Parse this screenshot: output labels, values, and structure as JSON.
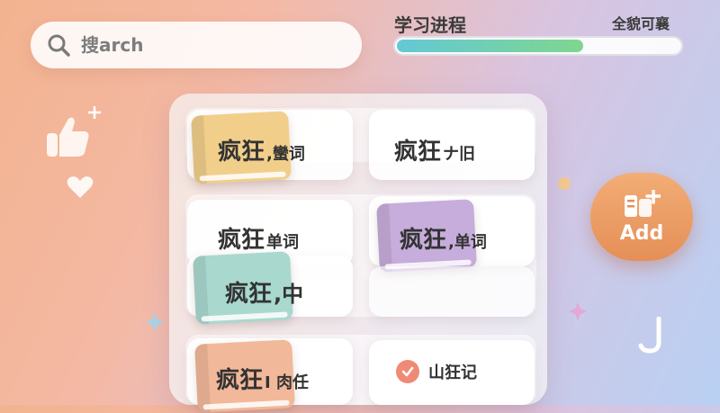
{
  "search": {
    "placeholder": "搜arch"
  },
  "progress": {
    "title": "学习进程",
    "right_label": "全貌可襄",
    "fraction": 0.66
  },
  "words": [
    {
      "main": "疯狂",
      "sub": ",蠻词"
    },
    {
      "main": "疯狂",
      "sub": "ナ旧"
    },
    {
      "main": "疯狂",
      "sub": "单词"
    },
    {
      "main": "疯狂",
      "sub": ",单词"
    },
    {
      "main": "疯狂",
      "sub": ",中"
    },
    {
      "main": "疯狂",
      "sub": "I 肉任"
    },
    {
      "main": "",
      "sub": "山狂记"
    }
  ],
  "add_button": {
    "label": "Add"
  },
  "colors": {
    "book_yellow": "#f1cf8b",
    "book_purple": "#c7addb",
    "book_teal": "#a9d8cf",
    "book_peach": "#f2b89a",
    "progress_fill": "#7fd68f",
    "add_orange": "#e99760",
    "check_red": "#ef8a74"
  },
  "icons": [
    "search-icon",
    "thumbs-up-icon",
    "heart-icon",
    "sparkle-icon",
    "add-cards-icon",
    "check-icon",
    "swirl-icon"
  ]
}
